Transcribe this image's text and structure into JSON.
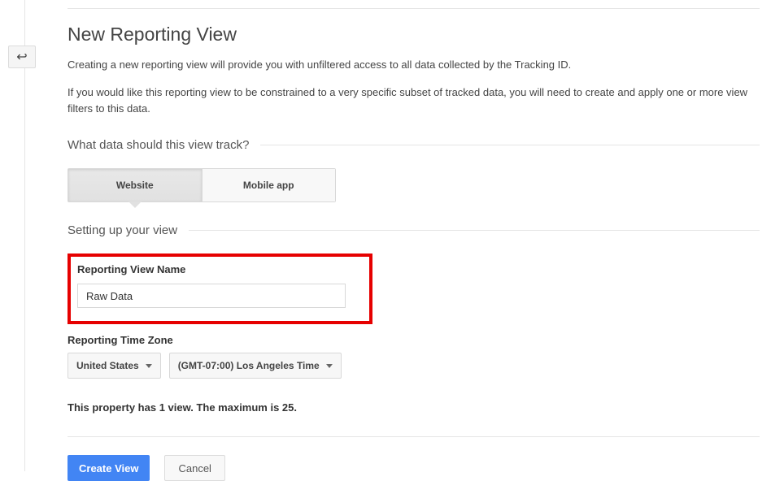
{
  "header": {
    "title": "New Reporting View",
    "description1": "Creating a new reporting view will provide you with unfiltered access to all data collected by the Tracking ID.",
    "description2": "If you would like this reporting view to be constrained to a very specific subset of tracked data, you will need to create and apply one or more view filters to this data."
  },
  "dataTypeSection": {
    "heading": "What data should this view track?",
    "options": [
      {
        "label": "Website",
        "selected": true
      },
      {
        "label": "Mobile app",
        "selected": false
      }
    ]
  },
  "viewSetupSection": {
    "heading": "Setting up your view",
    "nameField": {
      "label": "Reporting View Name",
      "value": "Raw Data"
    },
    "timezoneField": {
      "label": "Reporting Time Zone",
      "country": "United States",
      "zone": "(GMT-07:00) Los Angeles Time"
    }
  },
  "propertyNote": "This property has 1 view. The maximum is 25.",
  "actions": {
    "primary": "Create View",
    "cancel": "Cancel"
  }
}
